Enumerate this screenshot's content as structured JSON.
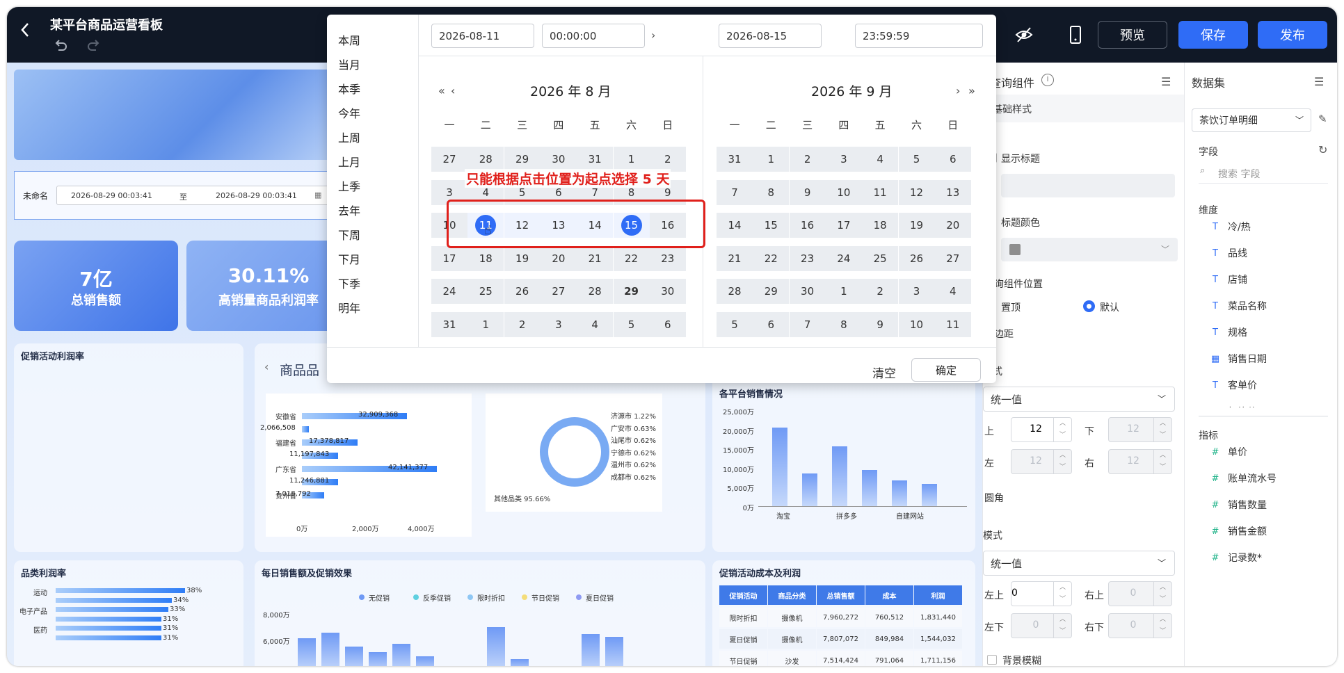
{
  "header": {
    "title": "某平台商品运营看板",
    "preview": "预览",
    "save": "保存",
    "publish": "发布"
  },
  "filter": {
    "label": "未命名",
    "start": "2026-08-29 00:03:41",
    "sep": "至",
    "end": "2026-08-29 00:03:41"
  },
  "kpis": [
    {
      "value": "7亿",
      "label": "总销售额"
    },
    {
      "value": "30.11%",
      "label": "高销量商品利润率"
    }
  ],
  "cards": {
    "promo_rate": "促销活动利润率",
    "category_prefix": "商品品",
    "platform": "各平台销售情况",
    "cat_profit": "品类利润率",
    "daily": "每日销售额及促销效果",
    "promo_cost": "促销活动成本及利润"
  },
  "hbar": {
    "rows": [
      {
        "label": "安徽省",
        "value": "32,909,368",
        "v": 32909368
      },
      {
        "label": "",
        "value": "2,066,508",
        "v": 2066508
      },
      {
        "label": "福建省",
        "value": "17,378,817",
        "v": 17378817
      },
      {
        "label": "",
        "value": "11,197,843",
        "v": 11197843
      },
      {
        "label": "广东省",
        "value": "42,141,377",
        "v": 42141377
      },
      {
        "label": "",
        "value": "11,246,881",
        "v": 11246881
      },
      {
        "label": "贵州省",
        "value": "7,018,792",
        "v": 7018792
      }
    ],
    "ticks": [
      "0万",
      "2,000万",
      "4,000万"
    ]
  },
  "donut": {
    "labels": [
      "济源市 1.22%",
      "广安市 0.63%",
      "汕尾市 0.62%",
      "宁德市 0.62%",
      "温州市 0.62%",
      "成都市 0.62%"
    ],
    "other": "其他品类 95.66%"
  },
  "platform_chart": {
    "yticks": [
      "25,000万",
      "20,000万",
      "15,000万",
      "10,000万",
      "5,000万",
      "0万"
    ],
    "xlabels": [
      "淘宝",
      "拼多多",
      "自建网站"
    ],
    "values": [
      20500,
      8500,
      15500,
      9500,
      6700,
      5800
    ]
  },
  "cat_chart": {
    "labels": [
      "运动",
      "",
      "电子产品",
      "",
      "医药",
      ""
    ],
    "values": [
      "38%",
      "34%",
      "33%",
      "31%",
      "31%",
      "31%"
    ]
  },
  "daily_chart": {
    "legend": [
      "无促销",
      "反季促销",
      "限时折扣",
      "节日促销",
      "夏日促销"
    ],
    "yticks": [
      "8,000万",
      "6,000万"
    ]
  },
  "promo_table": {
    "headers": [
      "促销活动",
      "商品分类",
      "总销售额",
      "成本",
      "利润"
    ],
    "rows": [
      [
        "限时折扣",
        "摄像机",
        "7,960,272",
        "760,512",
        "1,831,440"
      ],
      [
        "夏日促销",
        "摄像机",
        "7,807,072",
        "849,984",
        "1,544,032"
      ],
      [
        "节日促销",
        "沙发",
        "7,514,424",
        "791,064",
        "1,711,156"
      ]
    ]
  },
  "query_panel": {
    "title": "查询组件",
    "section": "基础样式",
    "show_title": "显示标题",
    "title_color": "标题颜色",
    "position": "查询组件位置",
    "pos_top": "置顶",
    "pos_default": "默认",
    "padding": "内边距",
    "mode": "模式",
    "mode_value": "统一值",
    "top": "上",
    "bottom": "下",
    "left": "左",
    "right": "右",
    "top_val": "12",
    "bottom_val": "12",
    "left_val": "12",
    "right_val": "12",
    "radius": "圆角",
    "mode2": "模式",
    "mode2_value": "统一值",
    "tl": "左上",
    "tr": "右上",
    "bl": "左下",
    "br": "右下",
    "tl_val": "0",
    "tr_val": "0",
    "bl_val": "0",
    "br_val": "0",
    "blur": "背景模糊"
  },
  "dataset": {
    "title": "数据集",
    "name": "茶饮订单明细",
    "fields_label": "字段",
    "search_placeholder": "搜索 字段",
    "dim_label": "维度",
    "dims": [
      "冷/热",
      "品线",
      "店铺",
      "菜品名称",
      "规格",
      "销售日期",
      "客单价",
      "杯均价"
    ],
    "measure_label": "指标",
    "measures": [
      "单价",
      "账单流水号",
      "销售数量",
      "销售金额",
      "记录数*"
    ]
  },
  "datepicker": {
    "quick": [
      "本周",
      "当月",
      "本季",
      "今年",
      "上周",
      "上月",
      "上季",
      "去年",
      "下周",
      "下月",
      "下季",
      "明年"
    ],
    "start_date": "2026-08-11",
    "start_time": "00:00:00",
    "end_date": "2026-08-15",
    "end_time": "23:59:59",
    "left_title": "2026 年 8 月",
    "right_title": "2026 年 9 月",
    "weekdays": [
      "一",
      "二",
      "三",
      "四",
      "五",
      "六",
      "日"
    ],
    "left_days": [
      "27",
      "28",
      "29",
      "30",
      "31",
      "1",
      "2",
      "3",
      "4",
      "5",
      "6",
      "7",
      "8",
      "9",
      "10",
      "11",
      "12",
      "13",
      "14",
      "15",
      "16",
      "17",
      "18",
      "19",
      "20",
      "21",
      "22",
      "23",
      "24",
      "25",
      "26",
      "27",
      "28",
      "29",
      "30",
      "31",
      "1",
      "2",
      "3",
      "4",
      "5",
      "6"
    ],
    "right_days": [
      "31",
      "1",
      "2",
      "3",
      "4",
      "5",
      "6",
      "7",
      "8",
      "9",
      "10",
      "11",
      "12",
      "13",
      "14",
      "15",
      "16",
      "17",
      "18",
      "19",
      "20",
      "21",
      "22",
      "23",
      "24",
      "25",
      "26",
      "27",
      "28",
      "29",
      "30",
      "1",
      "2",
      "3",
      "4",
      "5",
      "6",
      "7",
      "8",
      "9",
      "10",
      "11"
    ],
    "annotation": "只能根据点击位置为起点选择 5 天",
    "clear": "清空",
    "confirm": "确定",
    "accent": "#2f6cf6",
    "annot_color": "#e0201b"
  }
}
